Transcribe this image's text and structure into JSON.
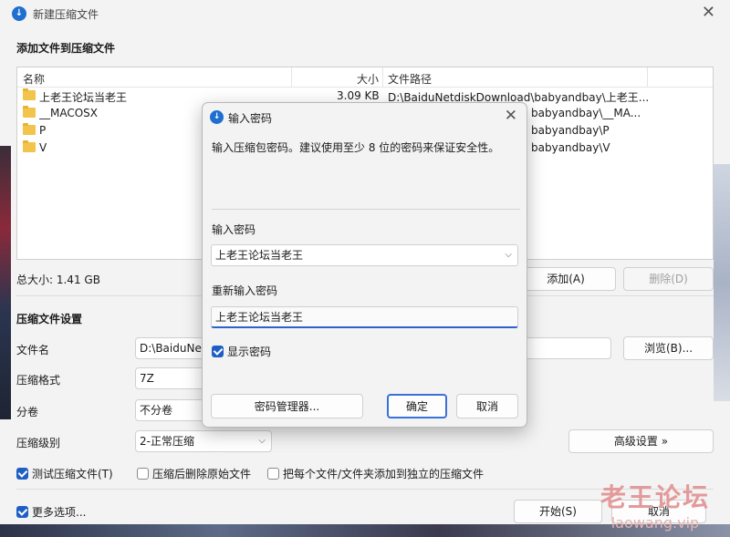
{
  "window": {
    "title": "新建压缩文件",
    "icon": "app-logo-icon"
  },
  "files_section": {
    "heading": "添加文件到压缩文件",
    "columns": {
      "name": "名称",
      "size": "大小",
      "path": "文件路径"
    },
    "rows": [
      {
        "name": "上老王论坛当老王",
        "size": "3.09 KB",
        "path": "D:\\BaiduNetdiskDownload\\babyandbay\\上老王..."
      },
      {
        "name": "__MACOSX",
        "size": "",
        "path": "babyandbay\\__MA..."
      },
      {
        "name": "P",
        "size": "",
        "path": "babyandbay\\P"
      },
      {
        "name": "V",
        "size": "",
        "path": "babyandbay\\V"
      }
    ],
    "total": "总大小: 1.41 GB",
    "add_button": "添加(A)",
    "remove_button": "删除(D)"
  },
  "settings_section": {
    "heading": "压缩文件设置",
    "filename_label": "文件名",
    "filename_value": "D:\\BaiduNet",
    "browse_button": "浏览(B)...",
    "format_label": "压缩格式",
    "format_value": "7Z",
    "split_label": "分卷",
    "split_value": "不分卷",
    "level_label": "压缩级别",
    "level_value": "2-正常压缩",
    "advanced_button": "高级设置 »",
    "test_check": "测试压缩文件(T)",
    "delete_check": "压缩后删除原始文件",
    "separate_check": "把每个文件/文件夹添加到独立的压缩文件",
    "more_check": "更多选项...",
    "start_button": "开始(S)",
    "cancel_button": "取消"
  },
  "dialog": {
    "title": "输入密码",
    "description": "输入压缩包密码。建议使用至少 8 位的密码来保证安全性。",
    "password_label": "输入密码",
    "password_value": "上老王论坛当老王",
    "reenter_label": "重新输入密码",
    "reenter_value": "上老王论坛当老王",
    "show_password": "显示密码",
    "manager_button": "密码管理器...",
    "ok_button": "确定",
    "cancel_button": "取消"
  },
  "watermark": {
    "line1": "老王论坛",
    "line2": "laowang.vip"
  }
}
